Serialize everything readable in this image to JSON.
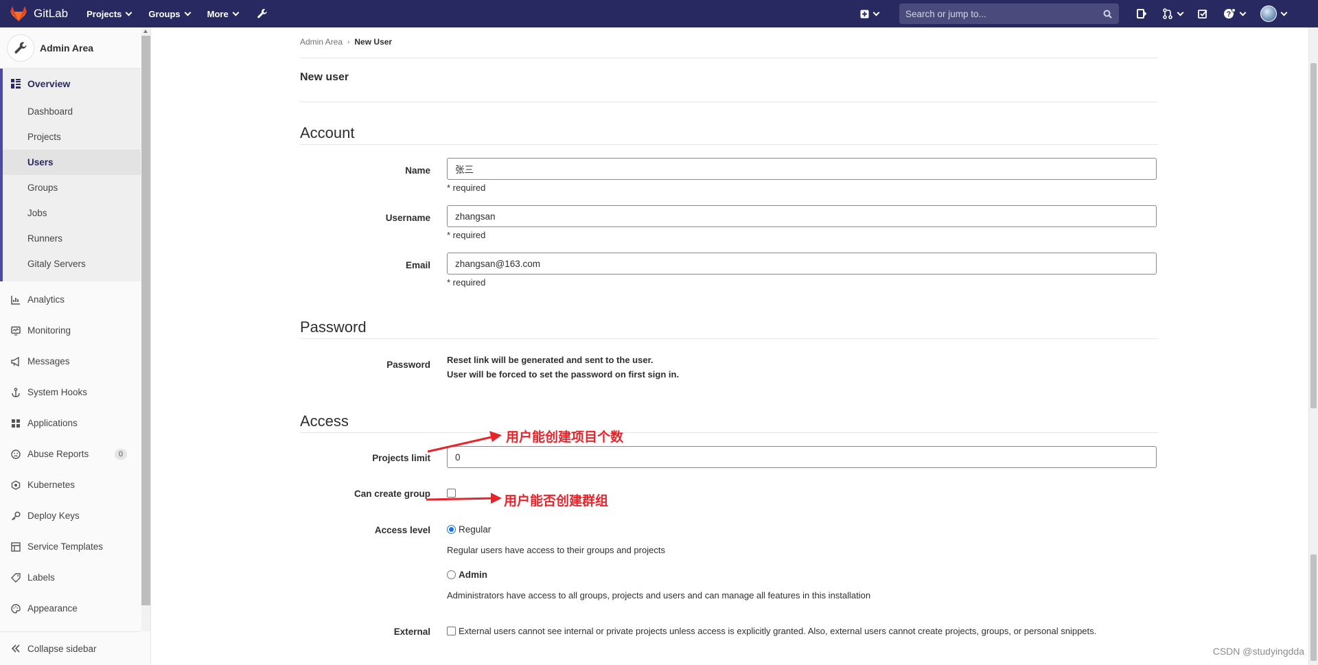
{
  "navbar": {
    "brand": "GitLab",
    "links": [
      {
        "label": "Projects"
      },
      {
        "label": "Groups"
      },
      {
        "label": "More"
      }
    ],
    "search_placeholder": "Search or jump to...",
    "accent": "#292961"
  },
  "sidebar": {
    "title": "Admin Area",
    "overview": {
      "label": "Overview",
      "items": [
        "Dashboard",
        "Projects",
        "Users",
        "Groups",
        "Jobs",
        "Runners",
        "Gitaly Servers"
      ],
      "active": "Users"
    },
    "items": [
      {
        "label": "Analytics",
        "icon": "chart-icon"
      },
      {
        "label": "Monitoring",
        "icon": "monitor-icon"
      },
      {
        "label": "Messages",
        "icon": "megaphone-icon"
      },
      {
        "label": "System Hooks",
        "icon": "anchor-icon"
      },
      {
        "label": "Applications",
        "icon": "grid-icon"
      },
      {
        "label": "Abuse Reports",
        "icon": "abuse-icon",
        "badge": "0"
      },
      {
        "label": "Kubernetes",
        "icon": "kubernetes-icon"
      },
      {
        "label": "Deploy Keys",
        "icon": "key-icon"
      },
      {
        "label": "Service Templates",
        "icon": "template-icon"
      },
      {
        "label": "Labels",
        "icon": "tag-icon"
      },
      {
        "label": "Appearance",
        "icon": "palette-icon"
      }
    ],
    "collapse_label": "Collapse sidebar"
  },
  "breadcrumb": {
    "parent": "Admin Area",
    "current": "New User"
  },
  "page_title": "New user",
  "account": {
    "title": "Account",
    "name_label": "Name",
    "name_value": "张三",
    "username_label": "Username",
    "username_value": "zhangsan",
    "email_label": "Email",
    "email_value": "zhangsan@163.com",
    "required": "* required"
  },
  "password": {
    "title": "Password",
    "label": "Password",
    "line1": "Reset link will be generated and sent to the user.",
    "line2": "User will be forced to set the password on first sign in."
  },
  "access": {
    "title": "Access",
    "projects_limit_label": "Projects limit",
    "projects_limit_value": "0",
    "can_create_group_label": "Can create group",
    "can_create_group_checked": false,
    "access_level_label": "Access level",
    "regular_label": "Regular",
    "regular_desc": "Regular users have access to their groups and projects",
    "admin_label": "Admin",
    "admin_desc": "Administrators have access to all groups, projects and users and can manage all features in this installation",
    "selected_level": "Regular",
    "external_label": "External",
    "external_desc": "External users cannot see internal or private projects unless access is explicitly granted. Also, external users cannot create projects, groups, or personal snippets."
  },
  "annotations": {
    "projects_limit": "用户能创建项目个数",
    "can_create_group": "用户能否创建群组",
    "color": "#e8242a"
  },
  "watermark": "CSDN @studyingdda"
}
